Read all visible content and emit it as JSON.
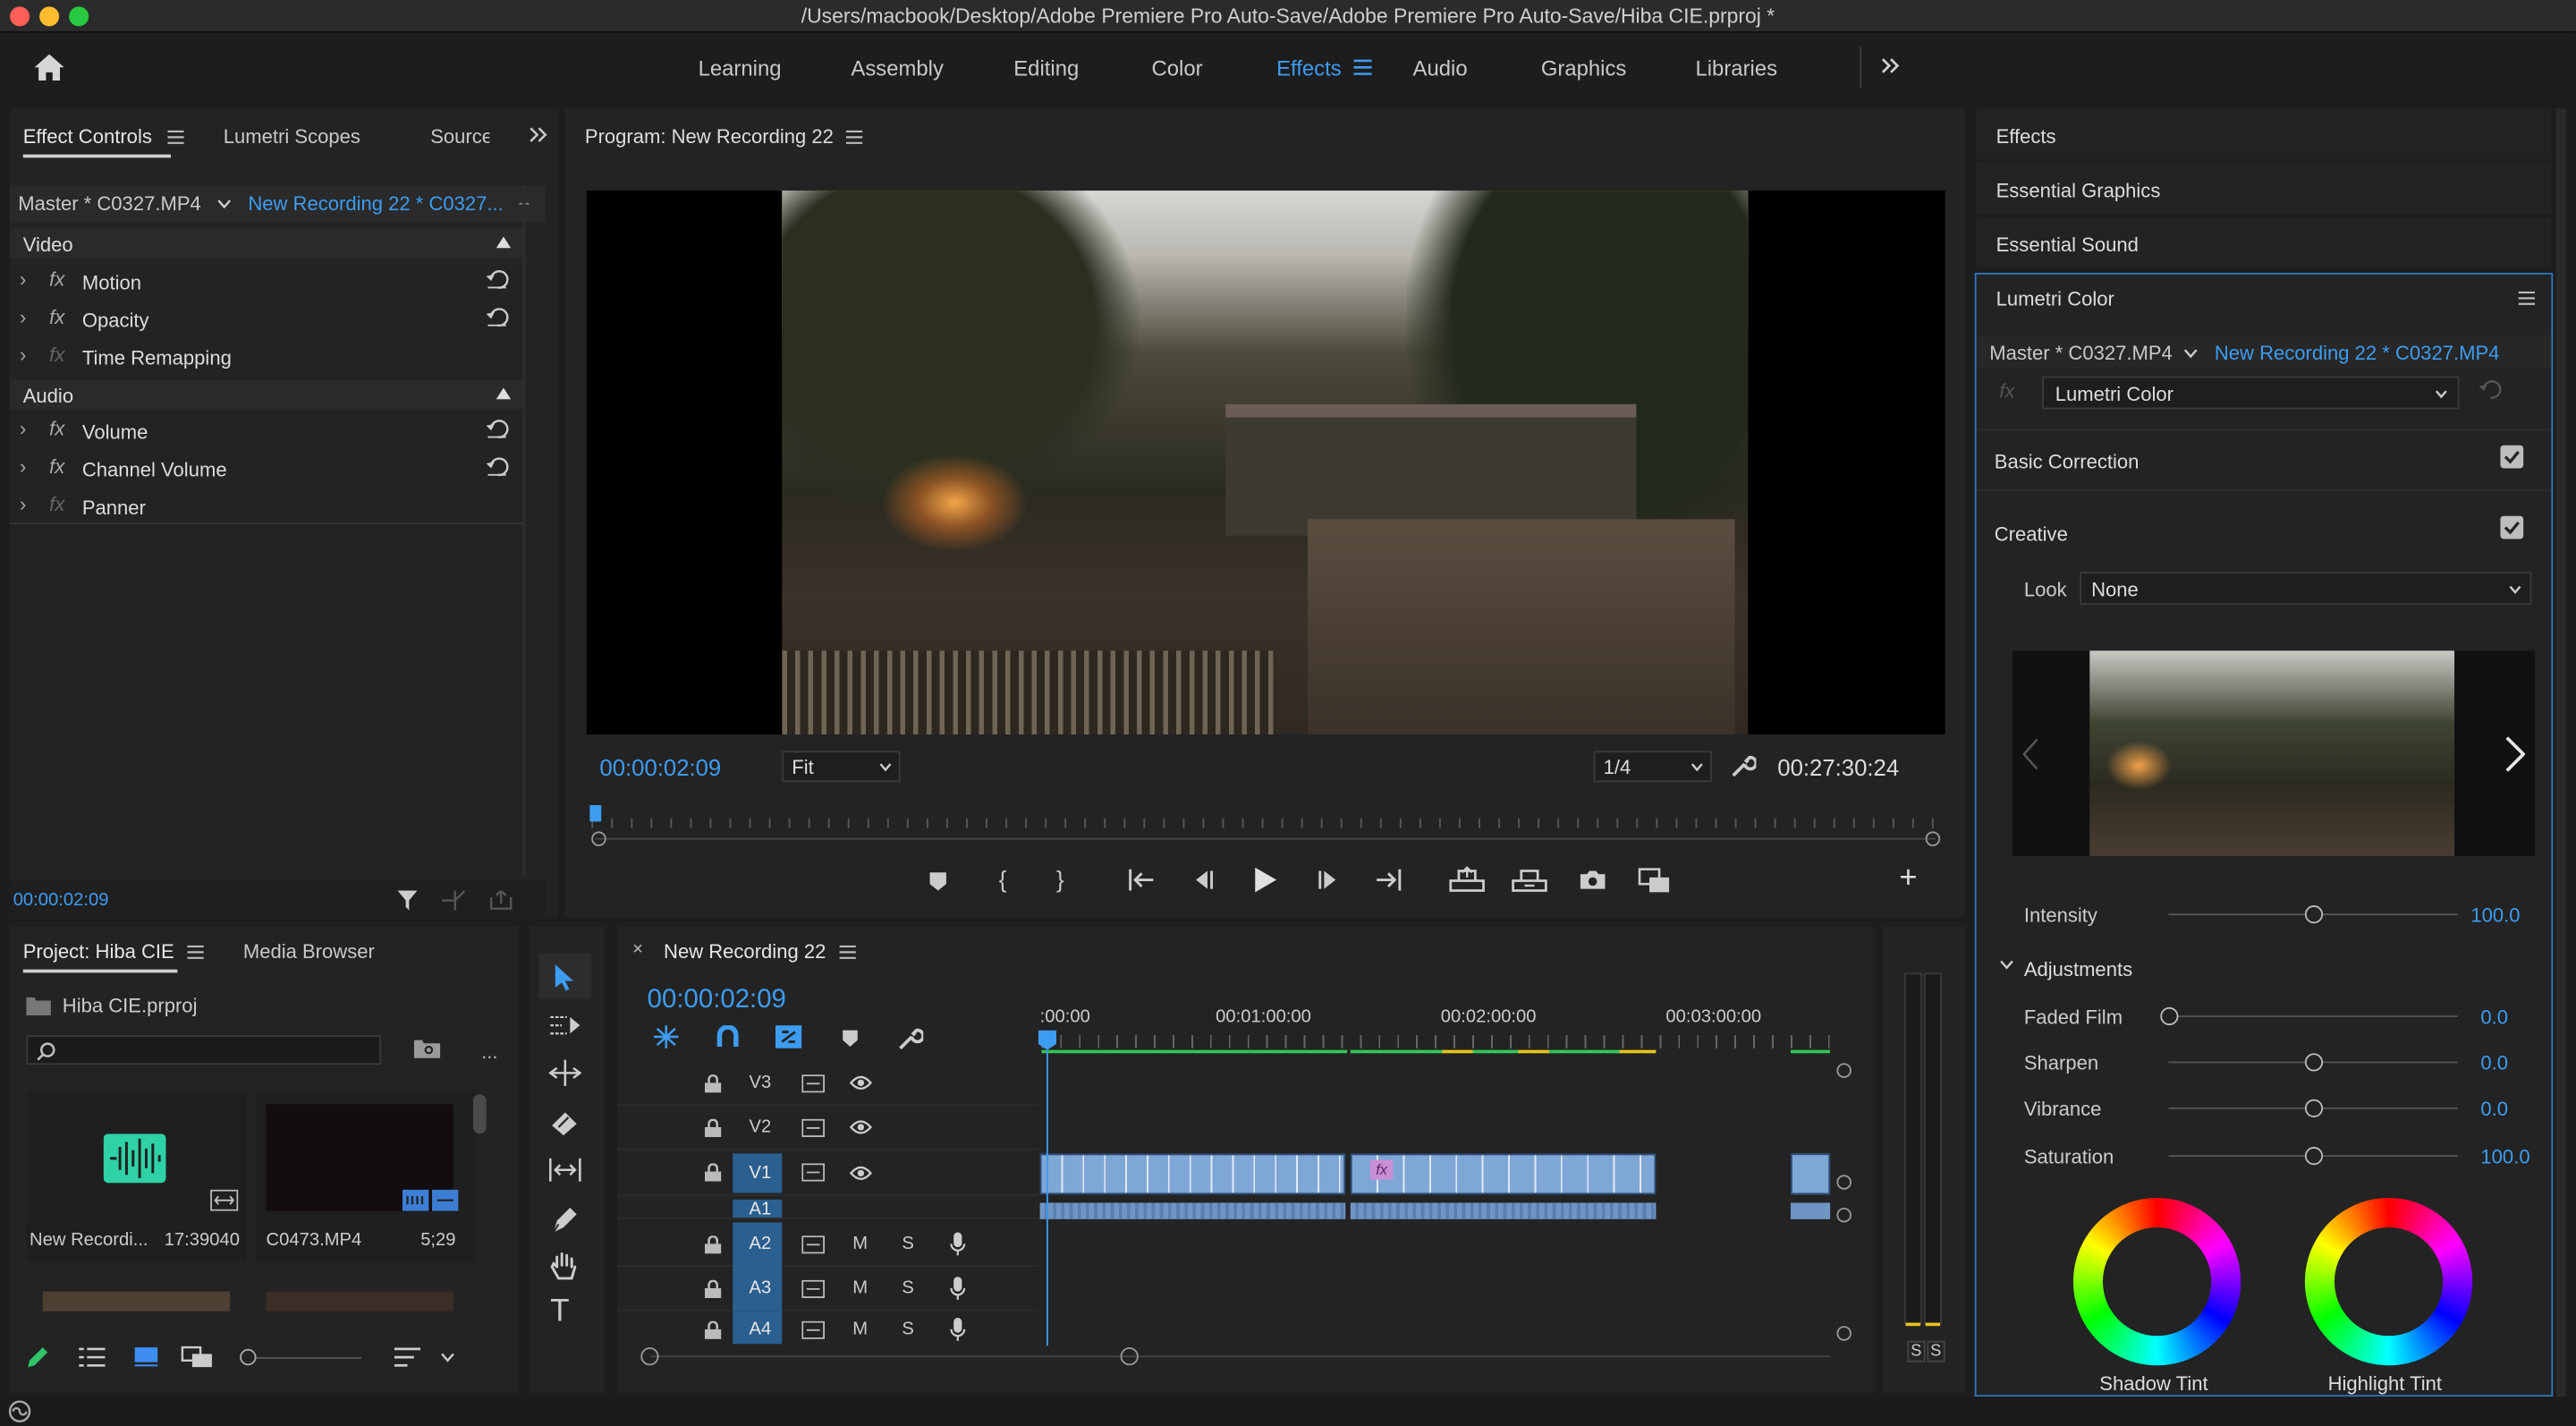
{
  "window": {
    "title": "/Users/macbook/Desktop/Adobe Premiere Pro Auto-Save/Adobe Premiere Pro Auto-Save/Hiba CIE.prproj *"
  },
  "workspaces": [
    "Learning",
    "Assembly",
    "Editing",
    "Color",
    "Effects",
    "Audio",
    "Graphics",
    "Libraries"
  ],
  "active_workspace": "Effects",
  "effect_controls": {
    "tabs": [
      "Effect Controls",
      "Lumetri Scopes",
      "Source"
    ],
    "master": "Master * C0327.MP4",
    "clip": "New Recording 22 * C0327...",
    "video_header": "Video",
    "video_items": [
      "Motion",
      "Opacity",
      "Time Remapping"
    ],
    "audio_header": "Audio",
    "audio_items": [
      "Volume",
      "Channel Volume",
      "Panner"
    ],
    "timecode": "00:00:02:09"
  },
  "program": {
    "title": "Program: New Recording 22",
    "timecode": "00:00:02:09",
    "fit": "Fit",
    "resolution": "1/4",
    "duration": "00:27:30:24"
  },
  "right_panels": {
    "effects": "Effects",
    "essential_graphics": "Essential Graphics",
    "essential_sound": "Essential Sound"
  },
  "lumetri": {
    "title": "Lumetri Color",
    "master": "Master * C0327.MP4",
    "clip": "New Recording 22 * C0327.MP4",
    "effect": "Lumetri Color",
    "basic_correction": "Basic Correction",
    "creative": "Creative",
    "look_label": "Look",
    "look_value": "None",
    "intensity_label": "Intensity",
    "intensity_value": "100.0",
    "intensity_level": 0.5,
    "adjustments": "Adjustments",
    "sliders": [
      {
        "label": "Faded Film",
        "value": "0.0",
        "level": 0
      },
      {
        "label": "Sharpen",
        "value": "0.0",
        "level": 0.5
      },
      {
        "label": "Vibrance",
        "value": "0.0",
        "level": 0.5
      },
      {
        "label": "Saturation",
        "value": "100.0",
        "level": 0.5
      }
    ],
    "wheels": [
      "Shadow Tint",
      "Highlight Tint"
    ]
  },
  "project": {
    "tabs": [
      "Project: Hiba CIE",
      "Media Browser"
    ],
    "file": "Hiba CIE.prproj",
    "search_placeholder": "",
    "ellipsis": "...",
    "items": [
      {
        "name": "New Recordi...",
        "duration": "17:39040"
      },
      {
        "name": "C0473.MP4",
        "duration": "5;29"
      }
    ]
  },
  "timeline": {
    "title": "New Recording 22",
    "timecode": "00:00:02:09",
    "ruler": [
      ":00:00",
      "00:01:00:00",
      "00:02:00:00",
      "00:03:00:00"
    ],
    "video_tracks": [
      "V3",
      "V2",
      "V1"
    ],
    "audio_tracks": [
      "A1",
      "A2",
      "A3",
      "A4"
    ],
    "mute_label": "M",
    "solo_label": "S"
  },
  "meter": {
    "labels": [
      "S",
      "S"
    ]
  },
  "colors": {
    "accent": "#3d9cf0",
    "clip": "#7fa7d6",
    "track_active": "#2a5f8f",
    "panel": "#232323"
  }
}
